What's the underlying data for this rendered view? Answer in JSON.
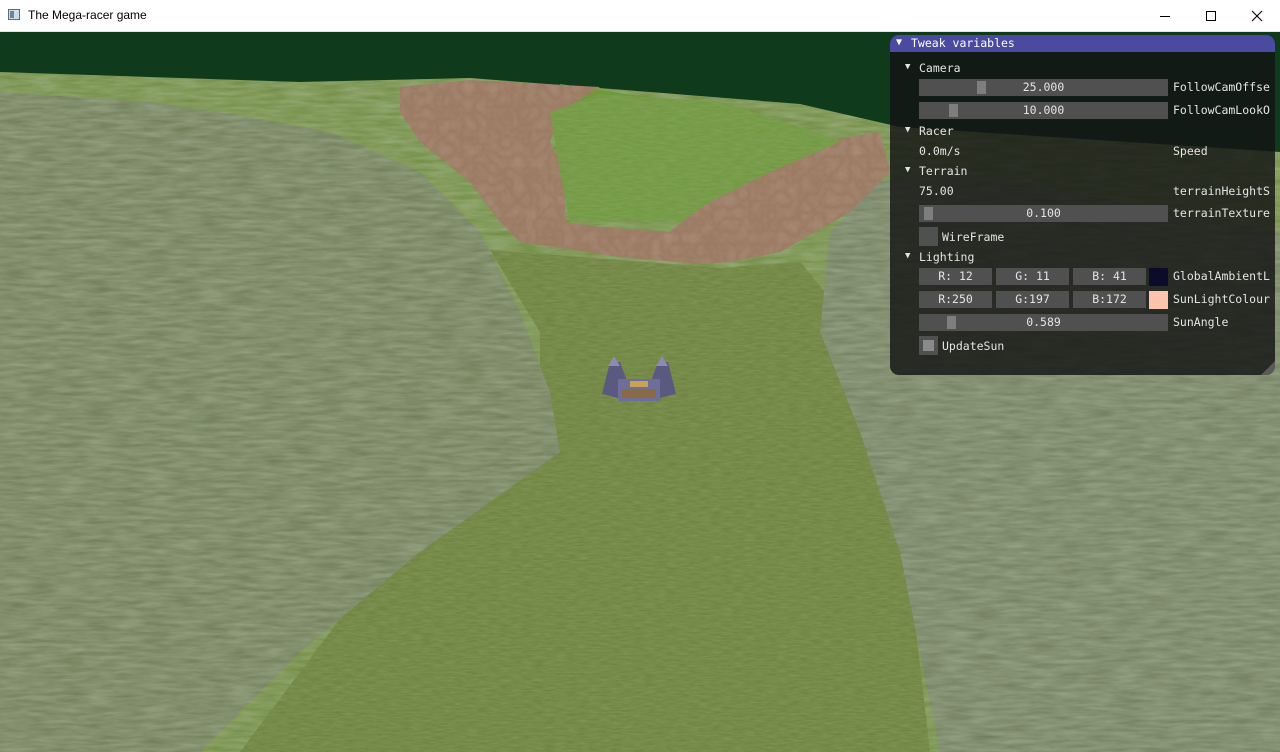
{
  "window": {
    "title": "The Mega-racer game",
    "icons": [
      "app-icon",
      "minimize-icon",
      "maximize-icon",
      "close-icon"
    ]
  },
  "panel": {
    "title": "Tweak variables",
    "camera": {
      "label": "Camera",
      "follow_offset": {
        "value": "25.000",
        "label": "FollowCamOffse",
        "level": 0.23
      },
      "follow_lookat": {
        "value": "10.000",
        "label": "FollowCamLookO",
        "level": 0.11
      }
    },
    "racer": {
      "label": "Racer",
      "speed_value": "0.0m/s",
      "speed_label": "Speed"
    },
    "terrain": {
      "label": "Terrain",
      "height_value": "75.00",
      "height_label": "terrainHeightS",
      "texture": {
        "value": "0.100",
        "label": "terrainTexture",
        "level": 0.0
      },
      "wireframe_label": "WireFrame"
    },
    "lighting": {
      "label": "Lighting",
      "ambient": {
        "r": "R: 12",
        "g": "G: 11",
        "b": "B: 41",
        "label": "GlobalAmbientL",
        "color": "#0c0b29"
      },
      "sun_colour": {
        "r": "R:250",
        "g": "G:197",
        "b": "B:172",
        "label": "SunLightColour",
        "color": "#fac5ac"
      },
      "sun_angle": {
        "value": "0.589",
        "label": "SunAngle",
        "level": 0.1
      },
      "update_sun_label": "UpdateSun"
    }
  },
  "colors": {
    "panel_header": "#4a4aa0",
    "sky": "#0f3a1c",
    "grass": "#5f7a3e",
    "dirt_track": "#9b7a62"
  }
}
